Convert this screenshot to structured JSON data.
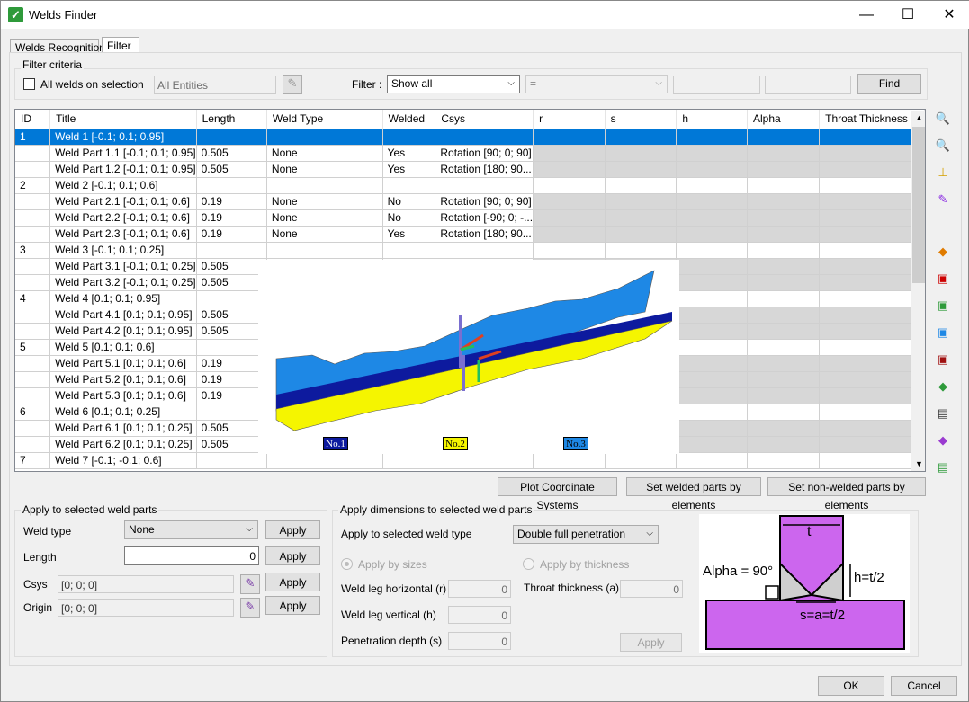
{
  "window": {
    "title": "Welds Finder",
    "minimize": "—",
    "maximize": "☐",
    "close": "✕"
  },
  "tabs": [
    "Welds Recognition",
    "Filter"
  ],
  "filter": {
    "group_label": "Filter criteria",
    "all_welds_label": "All welds on selection",
    "entities_placeholder": "All Entities",
    "filter_label": "Filter :",
    "filter_value": "Show all",
    "operator_value": "=",
    "find_label": "Find"
  },
  "table": {
    "columns": [
      "ID",
      "Title",
      "Length",
      "Weld Type",
      "Welded",
      "Csys",
      "r",
      "s",
      "h",
      "Alpha",
      "Throat Thickness (a)"
    ],
    "rows": [
      {
        "id": "1",
        "title": "Weld 1 [-0.1; 0.1; 0.95]",
        "length": "",
        "weld_type": "",
        "welded": "",
        "csys": "",
        "kind": "weld",
        "selected": true
      },
      {
        "id": "",
        "title": "Weld Part 1.1 [-0.1; 0.1; 0.95]",
        "length": "0.505",
        "weld_type": "None",
        "welded": "Yes",
        "csys": "Rotation [90; 0; 90]",
        "kind": "part"
      },
      {
        "id": "",
        "title": "Weld Part 1.2 [-0.1; 0.1; 0.95]",
        "length": "0.505",
        "weld_type": "None",
        "welded": "Yes",
        "csys": "Rotation [180; 90...",
        "kind": "part"
      },
      {
        "id": "2",
        "title": "Weld 2 [-0.1; 0.1; 0.6]",
        "length": "",
        "weld_type": "",
        "welded": "",
        "csys": "",
        "kind": "weld"
      },
      {
        "id": "",
        "title": "Weld Part 2.1 [-0.1; 0.1; 0.6]",
        "length": "0.19",
        "weld_type": "None",
        "welded": "No",
        "csys": "Rotation [90; 0; 90]",
        "kind": "part"
      },
      {
        "id": "",
        "title": "Weld Part 2.2 [-0.1; 0.1; 0.6]",
        "length": "0.19",
        "weld_type": "None",
        "welded": "No",
        "csys": "Rotation [-90; 0; -...",
        "kind": "part"
      },
      {
        "id": "",
        "title": "Weld Part 2.3 [-0.1; 0.1; 0.6]",
        "length": "0.19",
        "weld_type": "None",
        "welded": "Yes",
        "csys": "Rotation [180; 90...",
        "kind": "part"
      },
      {
        "id": "3",
        "title": "Weld 3 [-0.1; 0.1; 0.25]",
        "length": "",
        "weld_type": "",
        "welded": "",
        "csys": "",
        "kind": "weld"
      },
      {
        "id": "",
        "title": "Weld Part 3.1 [-0.1; 0.1; 0.25]",
        "length": "0.505",
        "weld_type": "",
        "welded": "",
        "csys": "",
        "kind": "part"
      },
      {
        "id": "",
        "title": "Weld Part 3.2 [-0.1; 0.1; 0.25]",
        "length": "0.505",
        "weld_type": "",
        "welded": "",
        "csys": "",
        "kind": "part"
      },
      {
        "id": "4",
        "title": "Weld 4 [0.1; 0.1; 0.95]",
        "length": "",
        "weld_type": "",
        "welded": "",
        "csys": "",
        "kind": "weld"
      },
      {
        "id": "",
        "title": "Weld Part 4.1 [0.1; 0.1; 0.95]",
        "length": "0.505",
        "weld_type": "",
        "welded": "",
        "csys": "",
        "kind": "part"
      },
      {
        "id": "",
        "title": "Weld Part 4.2 [0.1; 0.1; 0.95]",
        "length": "0.505",
        "weld_type": "",
        "welded": "",
        "csys": "",
        "kind": "part"
      },
      {
        "id": "5",
        "title": "Weld 5 [0.1; 0.1; 0.6]",
        "length": "",
        "weld_type": "",
        "welded": "",
        "csys": "",
        "kind": "weld"
      },
      {
        "id": "",
        "title": "Weld Part 5.1 [0.1; 0.1; 0.6]",
        "length": "0.19",
        "weld_type": "",
        "welded": "",
        "csys": "",
        "kind": "part"
      },
      {
        "id": "",
        "title": "Weld Part 5.2 [0.1; 0.1; 0.6]",
        "length": "0.19",
        "weld_type": "",
        "welded": "",
        "csys": "",
        "kind": "part"
      },
      {
        "id": "",
        "title": "Weld Part 5.3 [0.1; 0.1; 0.6]",
        "length": "0.19",
        "weld_type": "",
        "welded": "",
        "csys": "",
        "kind": "part"
      },
      {
        "id": "6",
        "title": "Weld 6 [0.1; 0.1; 0.25]",
        "length": "",
        "weld_type": "",
        "welded": "",
        "csys": "",
        "kind": "weld"
      },
      {
        "id": "",
        "title": "Weld Part 6.1 [0.1; 0.1; 0.25]",
        "length": "0.505",
        "weld_type": "",
        "welded": "",
        "csys": "",
        "kind": "part"
      },
      {
        "id": "",
        "title": "Weld Part 6.2 [0.1; 0.1; 0.25]",
        "length": "0.505",
        "weld_type": "",
        "welded": "",
        "csys": "",
        "kind": "part"
      },
      {
        "id": "7",
        "title": "Weld 7 [-0.1; -0.1; 0.6]",
        "length": "",
        "weld_type": "",
        "welded": "",
        "csys": "",
        "kind": "weld"
      }
    ]
  },
  "preview": {
    "labels": [
      "No.1",
      "No.2",
      "No.3"
    ]
  },
  "grid_buttons": {
    "plot_csys": "Plot Coordinate Systems",
    "set_welded": "Set welded parts by elements",
    "set_non_welded": "Set non-welded parts by elements"
  },
  "apply_parts": {
    "group_label": "Apply to selected weld parts",
    "weld_type_label": "Weld type",
    "weld_type_value": "None",
    "length_label": "Length",
    "length_value": "0",
    "csys_label": "Csys",
    "csys_value": "[0; 0; 0]",
    "origin_label": "Origin",
    "origin_value": "[0; 0; 0]",
    "apply_label": "Apply"
  },
  "apply_dims": {
    "group_label": "Apply dimensions to selected weld parts",
    "weld_type_label": "Apply to selected weld type",
    "weld_type_value": "Double full penetration",
    "by_sizes": "Apply by sizes",
    "by_thickness": "Apply by thickness",
    "leg_h_label": "Weld leg horizontal (r)",
    "leg_h_value": "0",
    "leg_v_label": "Weld leg vertical (h)",
    "leg_v_value": "0",
    "pen_label": "Penetration depth (s)",
    "pen_value": "0",
    "throat_label": "Throat thickness (a)",
    "throat_value": "0",
    "apply_label": "Apply"
  },
  "diagram": {
    "t": "t",
    "alpha": "Alpha = 90°",
    "h": "h=t/2",
    "s": "s=a=t/2"
  },
  "footer": {
    "ok": "OK",
    "cancel": "Cancel"
  },
  "colors": {
    "selection": "#0078d7",
    "plate": "#cc66ee",
    "weld_fill": "#cfcfcf"
  }
}
